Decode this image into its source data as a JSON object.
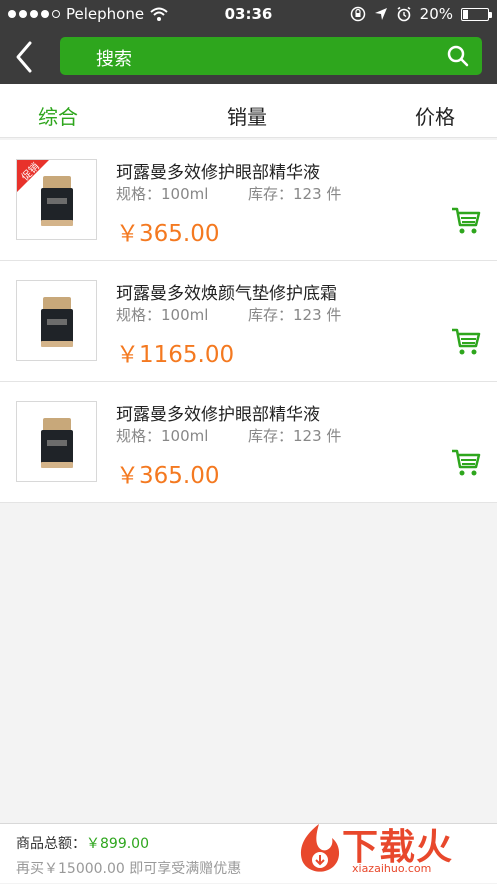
{
  "status_bar": {
    "carrier": "Pelephone",
    "time": "03:36",
    "battery": "20%",
    "battery_level": 0.2
  },
  "nav": {
    "search_label": "搜索"
  },
  "tabs": [
    {
      "label": "综合",
      "active": true
    },
    {
      "label": "销量",
      "active": false
    },
    {
      "label": "价格",
      "active": false
    }
  ],
  "products": [
    {
      "name": "珂露曼多效修护眼部精华液",
      "spec": "规格：100ml",
      "stock": "库存：123 件",
      "price": "￥365.00",
      "promo_badge": "促销"
    },
    {
      "name": "珂露曼多效焕颜气垫修护底霜",
      "spec": "规格：100ml",
      "stock": "库存：123 件",
      "price": "￥1165.00",
      "promo_badge": ""
    },
    {
      "name": "珂露曼多效修护眼部精华液",
      "spec": "规格：100ml",
      "stock": "库存：123 件",
      "price": "￥365.00",
      "promo_badge": ""
    }
  ],
  "footer": {
    "total_label": "商品总额：",
    "total_amount": "￥899.00",
    "promo_text": "再买￥15000.00 即可享受满赠优惠"
  },
  "watermark": {
    "text": "下载火",
    "url": "xiazaihuo.com"
  },
  "colors": {
    "accent": "#2ea61d",
    "price": "#f47920",
    "badge": "#e8322b",
    "navbar": "#3c3c3c"
  }
}
